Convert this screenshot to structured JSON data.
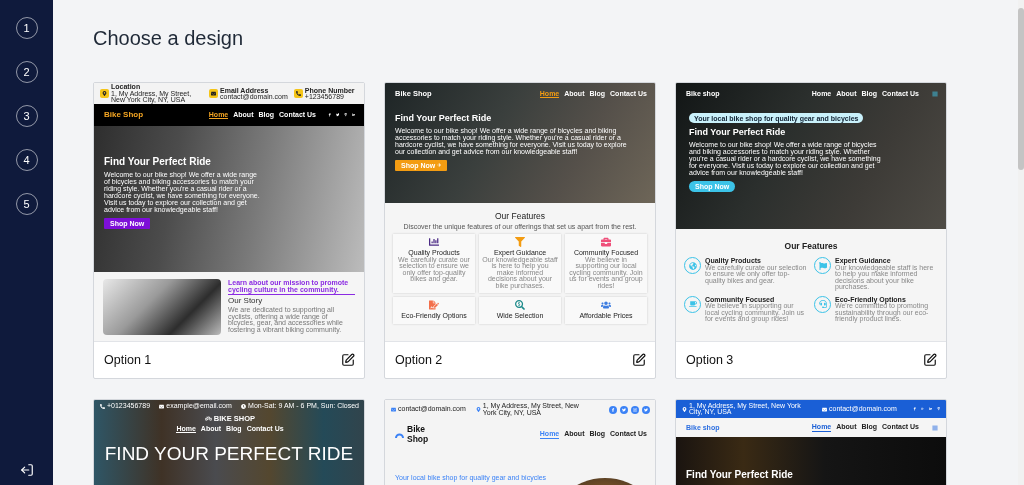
{
  "sidebar": {
    "steps": [
      "1",
      "2",
      "3",
      "4",
      "5"
    ]
  },
  "title": "Choose a design",
  "designs": [
    {
      "label": "Option 1",
      "sections": [
        {
          "kind": "contactbar",
          "items": [
            {
              "title": "Location",
              "text": "1, My Address, My Street, New York City, NY, USA"
            },
            {
              "title": "Email Address",
              "text": "contact@domain.com"
            },
            {
              "title": "Phone Number",
              "text": "+123456789"
            }
          ]
        },
        {
          "kind": "navbar",
          "brand": "Bike Shop",
          "links": [
            {
              "label": "Home",
              "selected": true
            },
            {
              "label": "About",
              "selected": false
            },
            {
              "label": "Blog",
              "selected": false
            },
            {
              "label": "Contact Us",
              "selected": false
            }
          ]
        },
        {
          "kind": "hero",
          "heading": "Find Your Perfect Ride",
          "text": "Welcome to our bike shop! We offer a wide range of bicycles and biking accessories to match your riding style. Whether you're a casual rider or a hardcore cyclist, we have something for everyone. Visit us today to explore our collection and get advice from our knowledgeable staff!",
          "button": "Shop Now"
        },
        {
          "kind": "story",
          "subtitle": "Learn about our mission to promote cycling culture in the community.",
          "heading": "Our Story",
          "text": "We are dedicated to supporting all cyclists, offering a wide range of bicycles, gear, and accessories while fostering a vibrant biking community."
        }
      ]
    },
    {
      "label": "Option 2",
      "sections": [
        {
          "kind": "hero",
          "header": [
            {
              "kind": "navbar",
              "brand": "Bike Shop",
              "links": [
                {
                  "label": "Home",
                  "selected": true
                },
                {
                  "label": "About",
                  "selected": false
                },
                {
                  "label": "Blog",
                  "selected": false
                },
                {
                  "label": "Contact Us",
                  "selected": false
                }
              ]
            }
          ],
          "heading": "Find Your Perfect Ride",
          "text": "Welcome to our bike shop! We offer a wide range of bicycles and biking accessories to match your riding style. Whether you're a casual rider or a hardcore cyclist, we have something for everyone. Visit us today to explore our collection and get advice from our knowledgeable staff!",
          "button": "Shop Now"
        },
        {
          "kind": "features",
          "heading": "Our Features",
          "subtitle": "Discover the unique features of our offerings that set us apart from the rest.",
          "items": [
            {
              "title": "Quality Products",
              "text": "We carefully curate our selection to ensure we only offer top-quality bikes and gear."
            },
            {
              "title": "Expert Guidance",
              "text": "Our knowledgeable staff is here to help you make informed decisions about your bike purchases."
            },
            {
              "title": "Community Focused",
              "text": "We believe in supporting our local cycling community. Join us for events and group rides!"
            },
            {
              "title": "Eco-Friendly Options"
            },
            {
              "title": "Wide Selection"
            },
            {
              "title": "Affordable Prices"
            }
          ]
        }
      ]
    },
    {
      "label": "Option 3",
      "sections": [
        {
          "kind": "hero",
          "header": [
            {
              "kind": "navbar",
              "brand": "Bike shop",
              "links": [
                {
                  "label": "Home",
                  "selected": false
                },
                {
                  "label": "About",
                  "selected": false
                },
                {
                  "label": "Blog",
                  "selected": false
                },
                {
                  "label": "Contact Us",
                  "selected": false
                }
              ]
            }
          ],
          "badge": "Your local bike shop for quality gear and bicycles",
          "heading": "Find Your Perfect Ride",
          "text": "Welcome to our bike shop! We offer a wide range of bicycles and biking accessories to match your riding style. Whether you're a casual rider or a hardcore cyclist, we have something for everyone. Visit us today to explore our collection and get advice from our knowledgeable staff!",
          "button": "Shop Now"
        },
        {
          "kind": "features",
          "heading": "Our Features",
          "items": [
            {
              "title": "Quality Products",
              "text": "We carefully curate our selection to ensure we only offer top-quality bikes and gear."
            },
            {
              "title": "Expert Guidance",
              "text": "Our knowledgeable staff is here to help you make informed decisions about your bike purchases."
            },
            {
              "title": "Community Focused",
              "text": "We believe in supporting our local cycling community. Join us for events and group rides!"
            },
            {
              "title": "Eco-Friendly Options",
              "text": "We're committed to promoting sustainability through our eco-friendly product lines."
            }
          ]
        }
      ]
    },
    {
      "sections": [
        {
          "kind": "hero",
          "header": [
            {
              "kind": "contactbar",
              "items": [
                {
                  "text": "+0123456789"
                },
                {
                  "text": "example@email.com"
                },
                {
                  "text": "Mon-Sat: 9 AM - 6 PM, Sun: Closed"
                }
              ]
            },
            {
              "kind": "navbar",
              "brand": "BIKE SHOP",
              "links": [
                {
                  "label": "Home",
                  "selected": true
                },
                {
                  "label": "About",
                  "selected": false
                },
                {
                  "label": "Blog",
                  "selected": false
                },
                {
                  "label": "Contact Us",
                  "selected": false
                }
              ]
            }
          ],
          "heading": "FIND YOUR PERFECT RIDE"
        }
      ]
    },
    {
      "sections": [
        {
          "kind": "contactbar",
          "items": [
            {
              "text": "contact@domain.com"
            },
            {
              "text": "1, My Address, My Street, New York City, NY, USA"
            }
          ]
        },
        {
          "kind": "navbar",
          "brand": "Bike Shop",
          "links": [
            {
              "label": "Home",
              "selected": true
            },
            {
              "label": "About",
              "selected": false
            },
            {
              "label": "Blog",
              "selected": false
            },
            {
              "label": "Contact Us",
              "selected": false
            }
          ]
        },
        {
          "kind": "hero",
          "tagline": "Your local bike shop for quality gear and bicycles"
        }
      ]
    },
    {
      "sections": [
        {
          "kind": "contactbar",
          "items": [
            {
              "text": "1, My Address, My Street, New York City, NY, USA"
            },
            {
              "text": "contact@domain.com"
            }
          ]
        },
        {
          "kind": "navbar",
          "brand": "Bike shop",
          "links": [
            {
              "label": "Home",
              "selected": true
            },
            {
              "label": "About",
              "selected": false
            },
            {
              "label": "Blog",
              "selected": false
            },
            {
              "label": "Contact Us",
              "selected": false
            }
          ]
        },
        {
          "kind": "hero",
          "heading": "Find Your Perfect Ride"
        }
      ]
    }
  ]
}
